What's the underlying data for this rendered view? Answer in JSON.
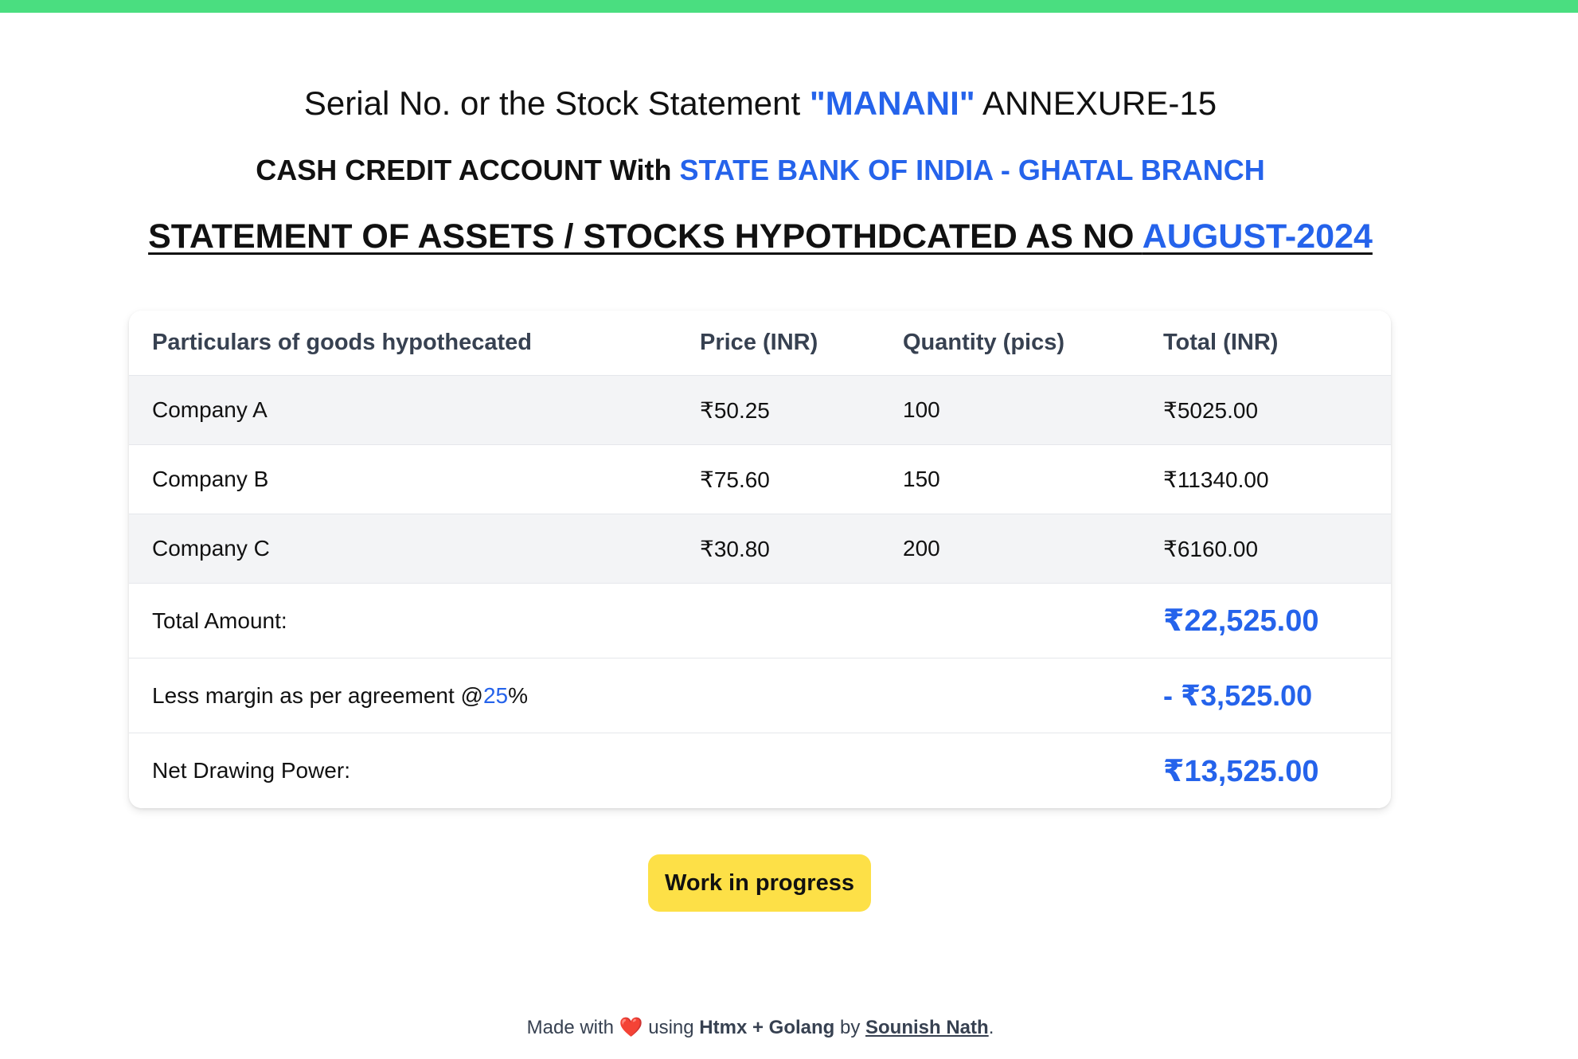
{
  "header": {
    "line1_prefix": "Serial No. or the Stock Statement ",
    "line1_name": "\"MANANI\"",
    "line1_suffix": " ANNEXURE-15",
    "line2_prefix": "CASH CREDIT ACCOUNT With ",
    "line2_bank": "STATE BANK OF INDIA - GHATAL BRANCH",
    "line3_prefix": "STATEMENT OF ASSETS / STOCKS HYPOTHDCATED AS NO ",
    "line3_period": "AUGUST-2024"
  },
  "table": {
    "columns": [
      "Particulars of goods hypothecated",
      "Price (INR)",
      "Quantity (pics)",
      "Total (INR)"
    ],
    "rows": [
      {
        "name": "Company A",
        "price": "₹50.25",
        "qty": "100",
        "total": "₹5025.00"
      },
      {
        "name": "Company B",
        "price": "₹75.60",
        "qty": "150",
        "total": "₹11340.00"
      },
      {
        "name": "Company C",
        "price": "₹30.80",
        "qty": "200",
        "total": "₹6160.00"
      }
    ],
    "total_label": "Total Amount:",
    "total_value": "₹22,525.00",
    "margin_label_prefix": "Less margin as per agreement @ ",
    "margin_percent": "25",
    "margin_label_suffix": "%",
    "margin_value": "- ₹3,525.00",
    "net_label": "Net Drawing Power:",
    "net_value": "₹13,525.00"
  },
  "button": {
    "label": "Work in progress"
  },
  "footer": {
    "made_with": "Made with ",
    "heart": "❤️",
    "using": " using ",
    "tech": "Htmx + Golang",
    "by": " by ",
    "author": "Sounish Nath",
    "end": "."
  },
  "colors": {
    "top_bar": "#4ade80",
    "accent": "#2563eb",
    "button_bg": "#fde047",
    "stripe": "#f3f4f6"
  }
}
